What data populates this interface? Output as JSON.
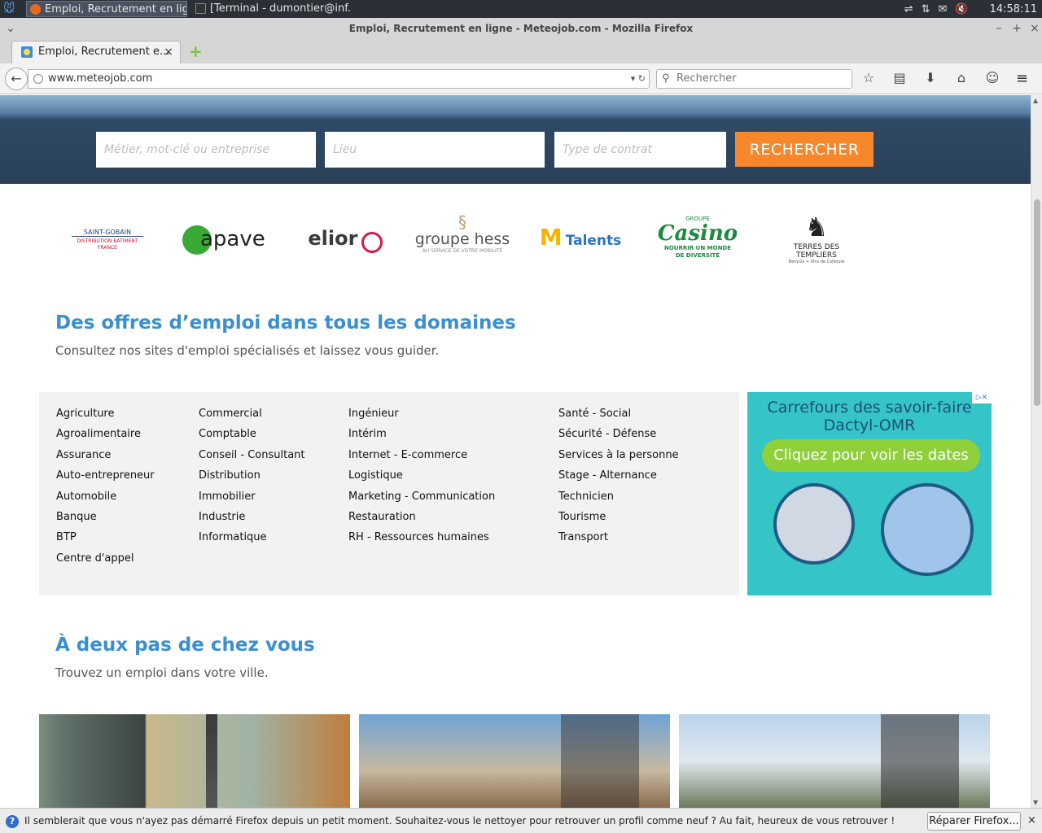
{
  "taskbar": {
    "tasks": [
      {
        "label": "Emploi, Recrutement en lig..."
      },
      {
        "label": "[Terminal - dumontier@inf..."
      }
    ],
    "clock": "14:58:11"
  },
  "window": {
    "title": "Emploi, Recrutement en ligne - Meteojob.com - Mozilla Firefox"
  },
  "tab": {
    "label": "Emploi, Recrutement e...",
    "close": "×"
  },
  "nav": {
    "url": "www.meteojob.com",
    "search_placeholder": "Rechercher"
  },
  "hero": {
    "job_placeholder": "Métier, mot-clé ou entreprise",
    "location_placeholder": "Lieu",
    "contract_placeholder": "Type de contrat",
    "search_button": "RECHERCHER"
  },
  "logos": [
    {
      "name": "SAINT-GOBAIN",
      "sub": "DISTRIBUTION BATIMENT FRANCE",
      "color": "#1e3f7a"
    },
    {
      "name": "apave",
      "color": "#222222",
      "accent": "#39a935"
    },
    {
      "name": "elior",
      "color": "#3b3b3b",
      "accent": "#d9194c"
    },
    {
      "name": "groupe hess",
      "sub": "AU SERVICE DE VOTRE MOBILITÉ",
      "color": "#555555"
    },
    {
      "name": "Talents",
      "color": "#2b73c6",
      "accent": "#f4b400"
    },
    {
      "name": "Casino",
      "top": "GROUPE",
      "sub": "NOURRIR UN MONDE DE DIVERSITÉ",
      "color": "#1a8a3c"
    },
    {
      "name": "TERRES DES TEMPLIERS",
      "sub": "Banyuls + Vins de Collioure",
      "color": "#222222",
      "accent": "#c8102e"
    }
  ],
  "section1": {
    "title": "Des offres d’emploi dans tous les domaines",
    "subtitle": "Consultez nos sites d'emploi spécialisés et laissez vous guider."
  },
  "categories": {
    "col1": [
      "Agriculture",
      "Agroalimentaire",
      "Assurance",
      "Auto-entrepreneur",
      "Automobile",
      "Banque",
      "BTP",
      "Centre d'appel"
    ],
    "col2": [
      "Commercial",
      "Comptable",
      "Conseil - Consultant",
      "Distribution",
      "Immobilier",
      "Industrie",
      "Informatique"
    ],
    "col3": [
      "Ingénieur",
      "Intérim",
      "Internet - E-commerce",
      "Logistique",
      "Marketing - Communication",
      "Restauration",
      "RH - Ressources humaines"
    ],
    "col4": [
      "Santé - Social",
      "Sécurité - Défense",
      "Services à la personne",
      "Stage - Alternance",
      "Technicien",
      "Tourisme",
      "Transport"
    ]
  },
  "ad": {
    "headline_line1": "Carrefours des savoir-faire",
    "headline_line2": "Dactyl-OMR",
    "button": "Cliquez pour voir les dates"
  },
  "section2": {
    "title": "À deux pas de chez vous",
    "subtitle": "Trouvez un emploi dans votre ville."
  },
  "notification": {
    "message": "Il semblerait que vous n'ayez pas démarré Firefox depuis un petit moment. Souhaitez-vous le nettoyer pour retrouver un profil comme neuf ? Au fait, heureux de vous retrouver !",
    "button": "Réparer Firefox...",
    "close": "×"
  },
  "colors": {
    "accent_blue": "#3a8fd0",
    "search_orange": "#f7872b",
    "ad_teal": "#35c5c6"
  }
}
